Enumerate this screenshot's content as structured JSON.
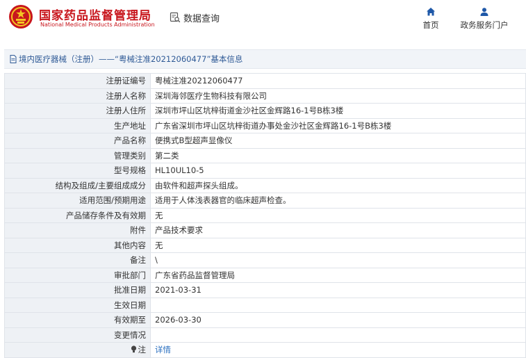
{
  "header": {
    "brand_cn": "国家药品监督管理局",
    "brand_en": "National Medical Products Administration",
    "query_label": "数据查询",
    "nav": [
      {
        "label": "首页",
        "icon": "home-icon"
      },
      {
        "label": "政务服务门户",
        "icon": "user-icon"
      }
    ]
  },
  "breadcrumb": {
    "text": "境内医疗器械（注册）——“粤械注准20212060477”基本信息",
    "icon": "document-icon"
  },
  "colors": {
    "brand_red": "#c8161d",
    "link_blue": "#2a6fc0",
    "crumb_blue": "#2f5a96",
    "key_bg": "#eef1f5"
  },
  "rows": [
    {
      "key": "注册证编号",
      "value": "粤械注准20212060477"
    },
    {
      "key": "注册人名称",
      "value": "深圳海邻医疗生物科技有限公司"
    },
    {
      "key": "注册人住所",
      "value": "深圳市坪山区坑梓街道金沙社区金辉路16-1号B栋3楼"
    },
    {
      "key": "生产地址",
      "value": "广东省深圳市坪山区坑梓街道办事处金沙社区金辉路16-1号B栋3楼"
    },
    {
      "key": "产品名称",
      "value": "便携式B型超声显像仪"
    },
    {
      "key": "管理类别",
      "value": "第二类"
    },
    {
      "key": "型号规格",
      "value": "HL10UL10-5"
    },
    {
      "key": "结构及组成/主要组成成分",
      "value": "由软件和超声探头组成。"
    },
    {
      "key": "适用范围/预期用途",
      "value": "适用于人体浅表器官的临床超声检查。"
    },
    {
      "key": "产品储存条件及有效期",
      "value": "无"
    },
    {
      "key": "附件",
      "value": "产品技术要求"
    },
    {
      "key": "其他内容",
      "value": "无"
    },
    {
      "key": "备注",
      "value": "\\"
    },
    {
      "key": "审批部门",
      "value": "广东省药品监督管理局"
    },
    {
      "key": "批准日期",
      "value": "2021-03-31"
    },
    {
      "key": "生效日期",
      "value": ""
    },
    {
      "key": "有效期至",
      "value": "2026-03-30"
    },
    {
      "key": "变更情况",
      "value": ""
    }
  ],
  "note_row": {
    "key": "注",
    "value": "详情",
    "icon": "lightbulb-icon"
  }
}
